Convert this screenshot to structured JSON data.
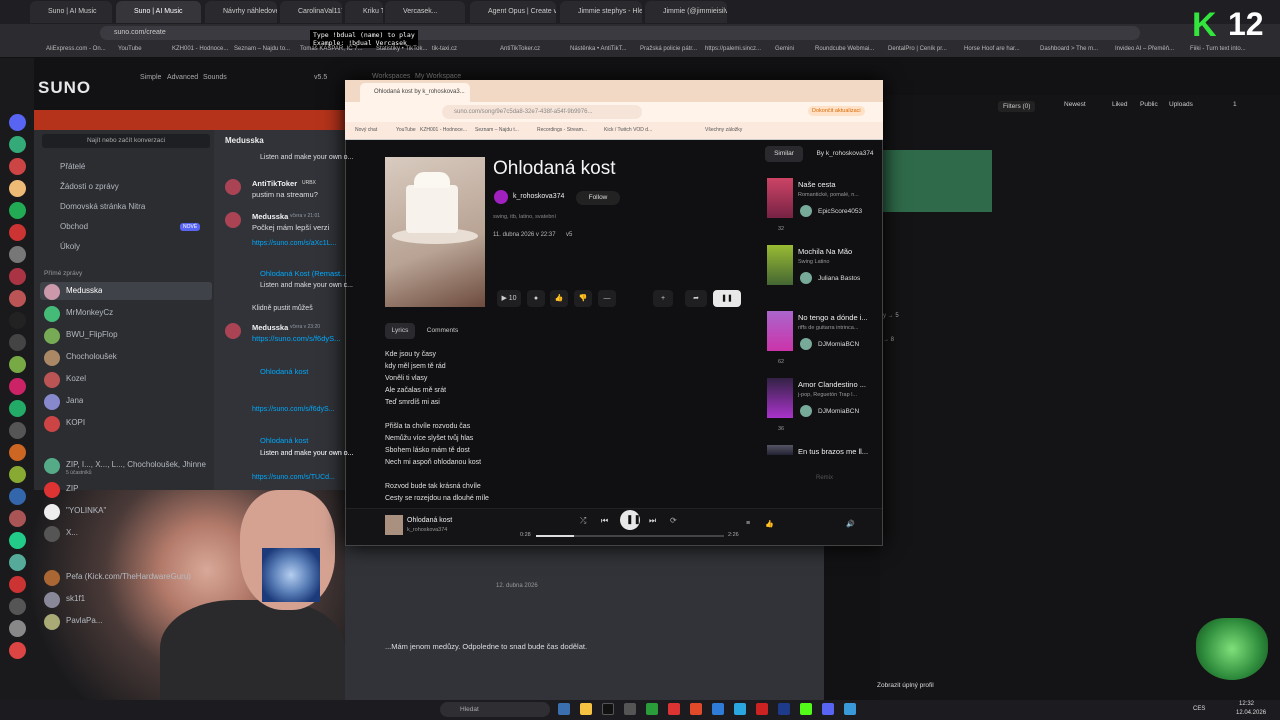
{
  "browser": {
    "tabs": [
      "Suno | AI Music",
      "Suno | AI Music",
      "Návrhy náhledovek v ...",
      "CarolinaVal117...",
      "Kriku TikT...",
      "Vercasek...",
      "Agent Opus | Create vid...",
      "Jimmie stephys - Hledat G...",
      "Jimmie (@jimmieisilve) | T..."
    ],
    "url": "suno.com/create",
    "bookmarks": [
      "AliExpress.com - On...",
      "YouTube",
      "KZH001 - Hodnoce...",
      "Seznam – Najdu to...",
      "Tomáš KAŠPAR, IČ 7...",
      "Statistiky • TikTok...",
      "tik-taxi.cz",
      "AntiTikToker.cz",
      "Nástěnka • AntiTikT...",
      "Pražská policie pátr...",
      "https://palemi.sincz...",
      "Gemini",
      "Roundcube Webmai...",
      "DentalPro | Ceník pr...",
      "Horse Hoof are har...",
      "Dashboard > The m...",
      "Invideo AI – Přeměň...",
      "Fiiki - Turn text into..."
    ]
  },
  "overlay_text": [
    "Type !bdual (name) to play",
    "Example: !bdual Vercasek"
  ],
  "suno": {
    "logo": "SUNO",
    "nav": [
      "Simple",
      "Advanced",
      "Sounds",
      "v5.5"
    ],
    "breadcrumb": [
      "Workspaces",
      "My Workspace"
    ],
    "filters": "Filters (0)",
    "sort": "Newest",
    "tabs": [
      "Liked",
      "Public",
      "Uploads"
    ],
    "page": "1",
    "right_items": [
      "y → 5",
      "→ 8"
    ],
    "show_profile": "Zobrazit úplný profil"
  },
  "discord": {
    "search": "Najít nebo začít konverzaci",
    "menu": [
      "Přátelé",
      "Žádosti o zprávy",
      "Domovská stránka Nitra",
      "Obchod",
      "Úkoly"
    ],
    "menu_badge_new": "NOVÉ",
    "dm_header": "Přímé zprávy",
    "dms": [
      "Medusska",
      "MrMonkeyCz",
      "BWU_FlipFlop",
      "Chocholoušek",
      "Kozel",
      "Jana",
      "KOPI",
      "ZIP, I..., X..., L..., Chocholoušek, Jhinney ...",
      "ZIP",
      "\"YOLINKA\"",
      "X...",
      "Pefa (Kick.com/TheHardwareGuru)",
      "sk1f1",
      "PavlaPa..."
    ],
    "dm_sub": "5 účastníků",
    "channel": "Medusska",
    "messages": [
      {
        "author": "",
        "text": "Listen and make your own o...",
        "time": ""
      },
      {
        "author": "AntiTikToker",
        "badge": "URBX",
        "time": "",
        "text": "pustim na streamu?"
      },
      {
        "author": "Medusska",
        "time": "včera v 21:01",
        "text": "Počkej mám lepší verzi"
      },
      {
        "author": "",
        "text": "https://suno.com/s/aXc1L...",
        "time": ""
      },
      {
        "author": "",
        "text": "Ohlodaná Kost (Remast...",
        "time": ""
      },
      {
        "author": "",
        "text": "Listen and make your own c...",
        "time": ""
      },
      {
        "author": "",
        "text": "Klidně pustit můžeš",
        "time": ""
      },
      {
        "author": "Medusska",
        "time": "včera v 23:20",
        "text": "https://suno.com/s/f6dyS..."
      },
      {
        "author": "",
        "text": "Ohlodaná kost",
        "time": ""
      },
      {
        "author": "",
        "text": "Listen and make your own o...",
        "time": ""
      },
      {
        "author": "",
        "text": "https://suno.com/s/f6dyS...",
        "time": ""
      },
      {
        "author": "",
        "text": "Ohlodaná kost",
        "time": ""
      },
      {
        "author": "",
        "text": "Listen and make your own o...",
        "time": ""
      },
      {
        "author": "",
        "text": "https://suno.com/s/TUCd...",
        "time": ""
      }
    ],
    "date_sep": "12. dubna 2026",
    "last_message": "...Mám jenom medůzy. Odpoledne to snad bude čas dodělat."
  },
  "popup": {
    "tab_title": "Ohlodaná kost by k_rohoskova3...",
    "url": "suno.com/song/9e7c5da8-32e7-438f-a54f-9b9976...",
    "update_btn": "Dokončit aktualizaci",
    "bookmarks": [
      "Nový chat",
      "YouTube",
      "KZH001 - Hodnoce...",
      "Seznam – Najdu t...",
      "Recordings - Stream...",
      "Kick / Twitch VOD d...",
      "Všechny záložky"
    ],
    "song": {
      "title": "Ohlodaná kost",
      "artist": "k_rohoskova374",
      "follow": "Follow",
      "tags": "swing, itb, latino, svatební",
      "date": "11. dubna 2026 v 22:37",
      "version": "v5",
      "plays": "10"
    },
    "tabs": [
      "Lyrics",
      "Comments"
    ],
    "lyrics": [
      "Kde jsou ty časy",
      "kdy měl jsem tě rád",
      "Voněli ti vlasy",
      "Ale začalas mě srát",
      "Teď smrdíš mi asi",
      "",
      "Přišla ta chvíle rozvodu čas",
      "Nemůžu více slyšet tvůj hlas",
      "Sbohem lásko mám tě dost",
      "Nech mi aspoň ohlodanou kost",
      "",
      "Rozvod bude tak krásná chvíle",
      "Cesty se rozejdou na dlouhé míle"
    ],
    "similar_tabs": [
      "Similar",
      "By k_rohoskova374"
    ],
    "similar": [
      {
        "title": "Naše cesta",
        "sub": "Romantické, pomalé, n...",
        "artist": "EpicScore4053",
        "likes": "32"
      },
      {
        "title": "Mochila Na Mão",
        "sub": "Swing Latino",
        "artist": "Juliana Bastos",
        "likes": ""
      },
      {
        "title": "No tengo a dónde i...",
        "sub": "riffs de guitarra intrinca...",
        "artist": "DJMomiaBCN",
        "likes": "62"
      },
      {
        "title": "Amor Clandestino ...",
        "sub": "j-pop, Reguetón Trap l...",
        "artist": "DJMomiaBCN",
        "likes": "36"
      },
      {
        "title": "En tus brazos me ll...",
        "sub": "",
        "artist": "",
        "likes": ""
      }
    ],
    "remix": "Remix",
    "player": {
      "title": "Ohlodaná kost",
      "artist": "k_rohoskova374",
      "elapsed": "0:28",
      "total": "2:26",
      "progress": 0.2
    }
  },
  "taskbar": {
    "search": "Hledat",
    "time": "12:32",
    "date": "12.04.2026",
    "lang": "CES"
  },
  "stream_badge": {
    "k": "K",
    "num": "12"
  },
  "colors": {
    "discord_bg": "#313338",
    "suno_bg": "#121214",
    "accent_red": "#b5331b",
    "k_green": "#32e63d",
    "link": "#00a8fc"
  }
}
